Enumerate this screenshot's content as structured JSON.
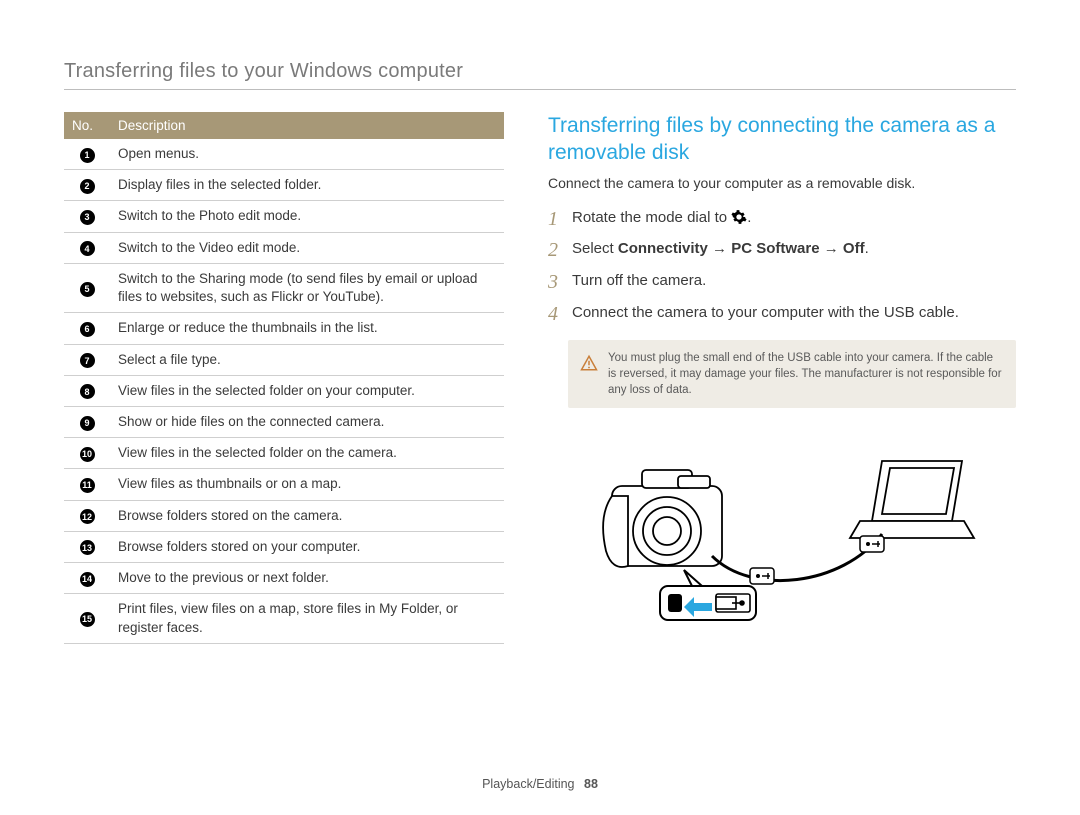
{
  "header": {
    "title": "Transferring files to your Windows computer"
  },
  "table": {
    "head_no": "No.",
    "head_desc": "Description",
    "rows": [
      {
        "n": "1",
        "d": "Open menus."
      },
      {
        "n": "2",
        "d": "Display files in the selected folder."
      },
      {
        "n": "3",
        "d": "Switch to the Photo edit mode."
      },
      {
        "n": "4",
        "d": "Switch to the Video edit mode."
      },
      {
        "n": "5",
        "d": "Switch to the Sharing mode (to send files by email or upload files to websites, such as Flickr or YouTube)."
      },
      {
        "n": "6",
        "d": "Enlarge or reduce the thumbnails in the list."
      },
      {
        "n": "7",
        "d": "Select a file type."
      },
      {
        "n": "8",
        "d": "View files in the selected folder on your computer."
      },
      {
        "n": "9",
        "d": "Show or hide files on the connected camera."
      },
      {
        "n": "10",
        "d": "View files in the selected folder on the camera."
      },
      {
        "n": "11",
        "d": "View files as thumbnails or on a map."
      },
      {
        "n": "12",
        "d": "Browse folders stored on the camera."
      },
      {
        "n": "13",
        "d": "Browse folders stored on your computer."
      },
      {
        "n": "14",
        "d": "Move to the previous or next folder."
      },
      {
        "n": "15",
        "d": "Print files, view files on a map, store files in My Folder, or register faces."
      }
    ]
  },
  "section": {
    "title": "Transferring files by connecting the camera as a removable disk",
    "intro": "Connect the camera to your computer as a removable disk.",
    "steps": {
      "s1_pre": "Rotate the mode dial to ",
      "s1_post": ".",
      "s2_pre": "Select ",
      "s2_b1": "Connectivity",
      "s2_arrow": " → ",
      "s2_b2": "PC Software",
      "s2_b3": "Off",
      "s2_post": ".",
      "s3": "Turn off the camera.",
      "s4": "Connect the camera to your computer with the USB cable."
    },
    "note": "You must plug the small end of the USB cable into your camera. If the cable is reversed, it may damage your files. The manufacturer is not responsible for any loss of data."
  },
  "footer": {
    "section": "Playback/Editing",
    "page": "88"
  }
}
